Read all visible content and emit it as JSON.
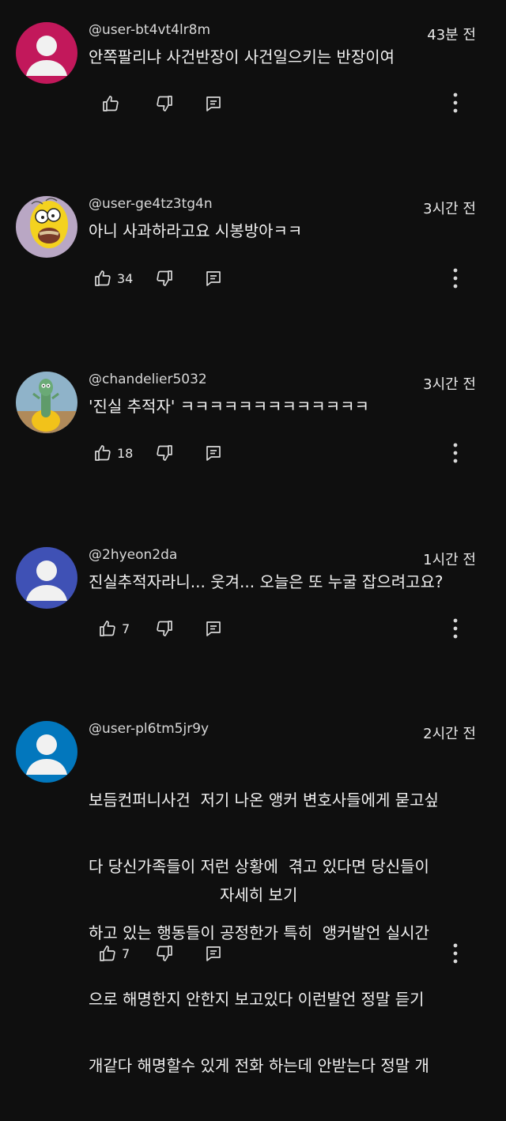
{
  "comments": [
    {
      "author": "@user-bt4vt4lr8m",
      "time": "43분 전",
      "text": "안쪽팔리냐 사건반장이 사건일으키는 반장이여",
      "likes": "",
      "avatar": "default-pink"
    },
    {
      "author": "@user-ge4tz3tg4n",
      "time": "3시간 전",
      "text": "아니 사과하라고요 시봉방아ㅋㅋ",
      "likes": "34",
      "avatar": "cartoon-character"
    },
    {
      "author": "@chandelier5032",
      "time": "3시간 전",
      "text": "'진실 추적자' ㅋㅋㅋㅋㅋㅋㅋㅋㅋㅋㅋㅋㅋ",
      "likes": "18",
      "avatar": "cartoon-character"
    },
    {
      "author": "@2hyeon2da",
      "time": "1시간 전",
      "text": "진실추적자라니... 웃겨... 오늘은 또 누굴 잡으려고요?",
      "likes": "7",
      "avatar": "default-indigo"
    },
    {
      "author": "@user-pl6tm5jr9y",
      "time": "2시간 전",
      "text_lines": [
        "보듬컨퍼니사건  저기 나온 앵커 변호사들에게 묻고싶",
        "다 당신가족들이 저런 상황에  겪고 있다면 당신들이",
        "하고 있는 행동들이 공정한가 특히  앵커발언 실시간",
        "으로 해명한지 안한지 보고있다 이런발언 정말 듣기",
        "개같다 해명할수 있게 전화 하는데 안받는다 정말 개"
      ],
      "read_more": "자세히 보기",
      "likes": "7",
      "avatar": "default-blue"
    }
  ],
  "colors": {
    "background": "#0f0f0f",
    "avatar_pink": "#c2185b",
    "avatar_indigo": "#3f51b5",
    "avatar_blue": "#0277bd"
  },
  "icons": [
    "like-icon",
    "dislike-icon",
    "reply-icon",
    "more-vert-icon"
  ]
}
